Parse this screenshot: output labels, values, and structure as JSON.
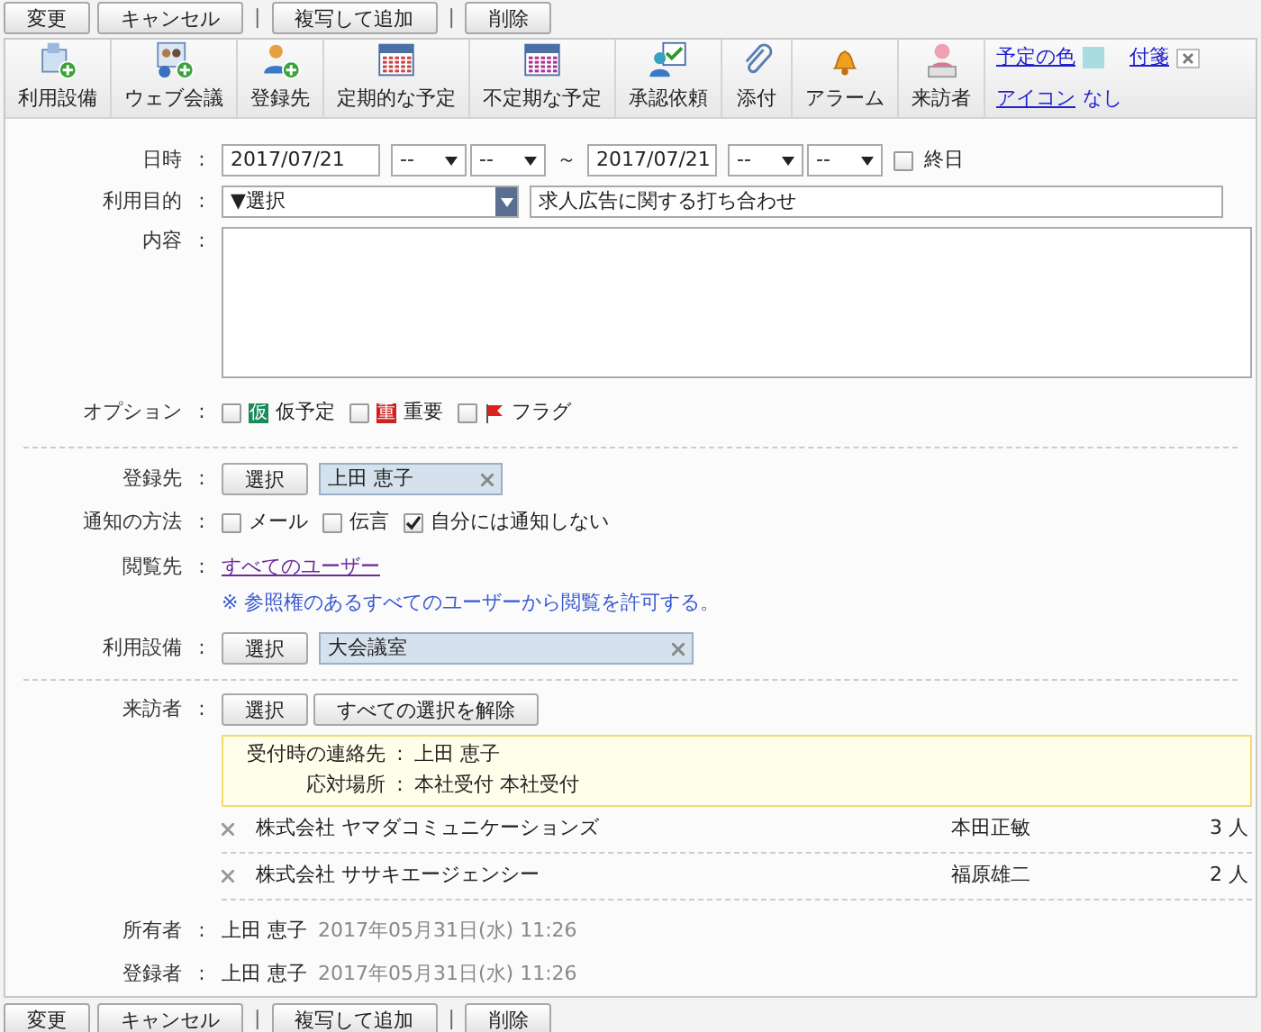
{
  "top_actions": [
    {
      "kind": "button",
      "label": "変更"
    },
    {
      "kind": "button",
      "label": "キャンセル"
    },
    {
      "kind": "separator",
      "label": "|"
    },
    {
      "kind": "button",
      "label": "複写して追加"
    },
    {
      "kind": "separator",
      "label": "|"
    },
    {
      "kind": "button",
      "label": "削除"
    }
  ],
  "toolbar": {
    "items": [
      {
        "kind": "facility",
        "label": "利用設備"
      },
      {
        "kind": "web-meeting",
        "label": "ウェブ会議"
      },
      {
        "kind": "contact",
        "label": "登録先"
      },
      {
        "kind": "recurring",
        "label": "定期的な予定"
      },
      {
        "kind": "irregular",
        "label": "不定期な予定"
      },
      {
        "kind": "approval",
        "label": "承認依頼"
      },
      {
        "kind": "attachment",
        "label": "添付"
      },
      {
        "kind": "alarm",
        "label": "アラーム"
      },
      {
        "kind": "visitor",
        "label": "来訪者"
      }
    ],
    "color_link": "予定の色",
    "color": "#a8dce0",
    "tag_link": "付箋",
    "icon_link": "アイコン",
    "icon_value": "なし"
  },
  "form": {
    "datetime": {
      "label": "日時",
      "colon": ":",
      "start_date": "2017/07/21",
      "start_hour": "--",
      "start_minute": "--",
      "range_mark": "～",
      "end_date": "2017/07/21",
      "end_hour": "--",
      "end_minute": "--",
      "all_day": {
        "label": "終日",
        "checked": false
      }
    },
    "purpose": {
      "label": "利用目的",
      "colon": ":",
      "select": "▼選択",
      "value": "求人広告に関する打ち合わせ"
    },
    "content": {
      "label": "内容",
      "colon": ":"
    },
    "options": {
      "label": "オプション",
      "colon": ":",
      "items": [
        {
          "kind": "tentative",
          "badge": "仮",
          "label": "仮予定",
          "checked": false
        },
        {
          "kind": "important",
          "badge": "重",
          "label": "重要",
          "checked": false
        },
        {
          "kind": "flag",
          "label": "フラグ",
          "checked": false
        }
      ]
    },
    "registrant": {
      "label": "登録先",
      "colon": ":",
      "button": "選択",
      "tag": "上田 恵子"
    },
    "notify": {
      "label": "通知の方法",
      "colon": ":",
      "items": [
        {
          "label": "メール",
          "checked": false
        },
        {
          "label": "伝言",
          "checked": false
        },
        {
          "label": "自分には通知しない",
          "checked": true
        }
      ]
    },
    "viewers": {
      "label": "閲覧先",
      "colon": ":",
      "link": "すべてのユーザー",
      "note": "※ 参照権のあるすべてのユーザーから閲覧を許可する。"
    },
    "facility": {
      "label": "利用設備",
      "colon": ":",
      "button": "選択",
      "tag": "大会議室"
    },
    "visitors": {
      "label": "来訪者",
      "colon": ":",
      "buttons": [
        "選択",
        "すべての選択を解除"
      ],
      "reception": [
        {
          "label": "受付時の連絡先",
          "colon": ":",
          "value": "上田 恵子"
        },
        {
          "label": "応対場所",
          "colon": ":",
          "value": "本社受付 本社受付"
        }
      ],
      "rows": [
        {
          "company": "株式会社 ヤマダコミュニケーションズ",
          "person": "本田正敏",
          "count": "3 人"
        },
        {
          "company": "株式会社 ササキエージェンシー",
          "person": "福原雄二",
          "count": "2 人"
        }
      ]
    },
    "owner": {
      "label": "所有者",
      "colon": ":",
      "name": "上田 恵子",
      "time": "2017年05月31日(水) 11:26"
    },
    "creator": {
      "label": "登録者",
      "colon": ":",
      "name": "上田 恵子",
      "time": "2017年05月31日(水) 11:26"
    }
  },
  "bottom_actions": [
    {
      "kind": "button",
      "label": "変更"
    },
    {
      "kind": "button",
      "label": "キャンセル"
    },
    {
      "kind": "separator",
      "label": "|"
    },
    {
      "kind": "button",
      "label": "複写して追加"
    },
    {
      "kind": "separator",
      "label": "|"
    },
    {
      "kind": "button",
      "label": "削除"
    }
  ]
}
